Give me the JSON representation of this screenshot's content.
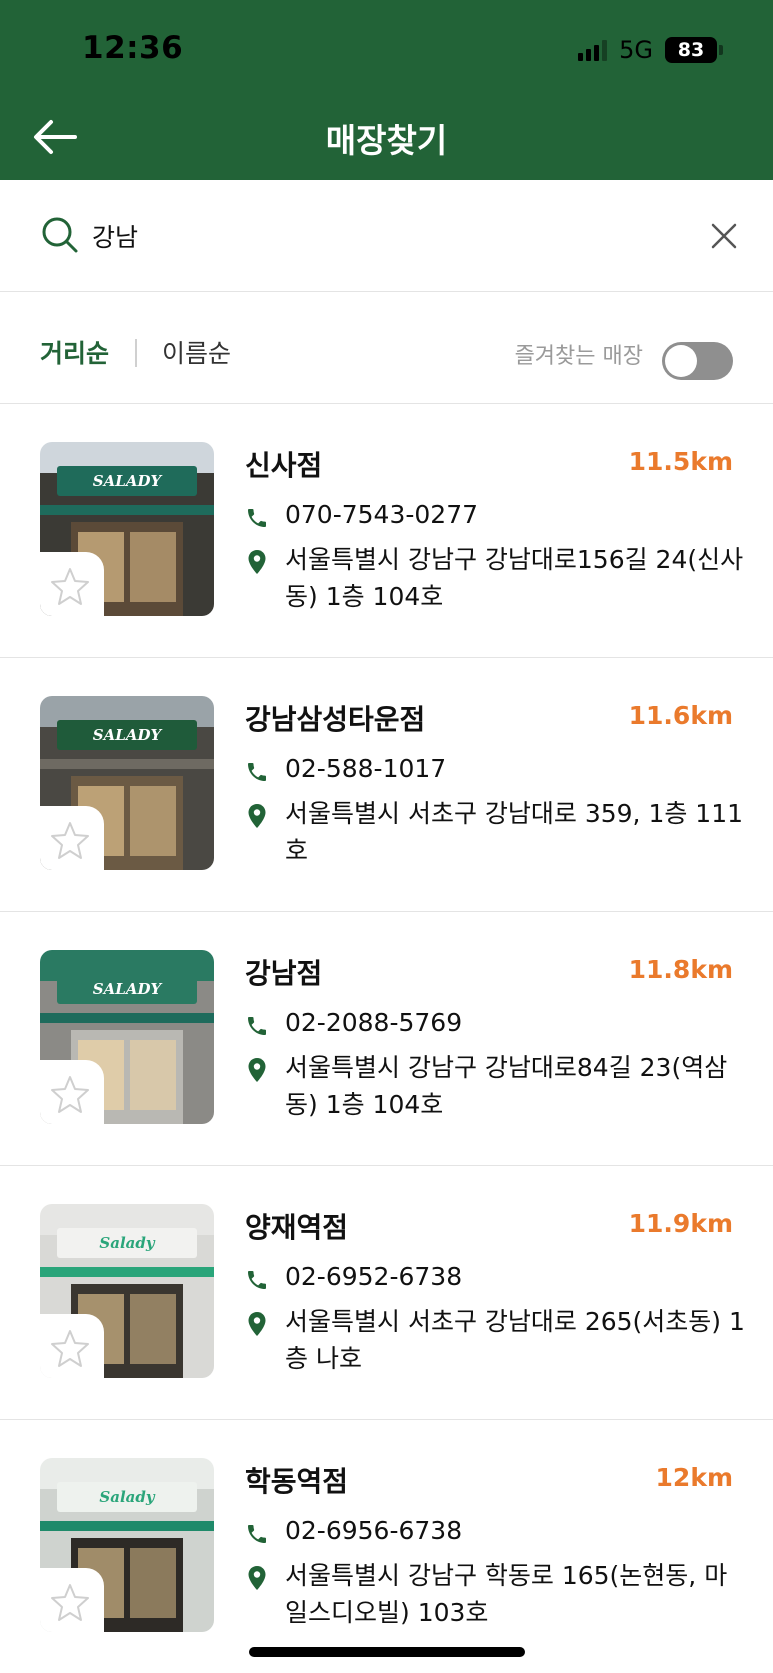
{
  "status_bar": {
    "time": "12:36",
    "network": "5G",
    "battery": "83"
  },
  "header": {
    "title": "매장찾기"
  },
  "search": {
    "value": "강남",
    "placeholder": ""
  },
  "sort": {
    "distance_label": "거리순",
    "name_label": "이름순",
    "favorites_label": "즐겨찾는 매장",
    "favorites_on": false
  },
  "colors": {
    "brand_green": "#226337",
    "distance_orange": "#ea7a2c"
  },
  "stores": [
    {
      "name": "신사점",
      "distance": "11.5km",
      "phone": "070-7543-0277",
      "address": "서울특별시 강남구 강남대로156길 24(신사동) 1층 104호",
      "favorite": false
    },
    {
      "name": "강남삼성타운점",
      "distance": "11.6km",
      "phone": "02-588-1017",
      "address": "서울특별시 서초구 강남대로 359, 1층 111호",
      "favorite": false
    },
    {
      "name": "강남점",
      "distance": "11.8km",
      "phone": "02-2088-5769",
      "address": "서울특별시 강남구 강남대로84길 23(역삼동) 1층 104호",
      "favorite": false
    },
    {
      "name": "양재역점",
      "distance": "11.9km",
      "phone": "02-6952-6738",
      "address": "서울특별시 서초구 강남대로 265(서초동) 1층 나호",
      "favorite": false
    },
    {
      "name": "학동역점",
      "distance": "12km",
      "phone": "02-6956-6738",
      "address": "서울특별시 강남구 학동로 165(논현동, 마일스디오빌) 103호",
      "favorite": false
    }
  ],
  "thumbnails": [
    {
      "sign_text": "SALADY",
      "sign_bg": "#1f6b5a",
      "sign_fg": "#ffffff"
    },
    {
      "sign_text": "SALADY",
      "sign_bg": "#1f5b3a",
      "sign_fg": "#ffffff"
    },
    {
      "sign_text": "SALADY",
      "sign_bg": "#2a7a62",
      "sign_fg": "#ffffff"
    },
    {
      "sign_text": "Salady",
      "sign_bg": "#f2f2f0",
      "sign_fg": "#2aa57a"
    },
    {
      "sign_text": "Salady",
      "sign_bg": "#eef2ee",
      "sign_fg": "#2aa57a"
    }
  ]
}
